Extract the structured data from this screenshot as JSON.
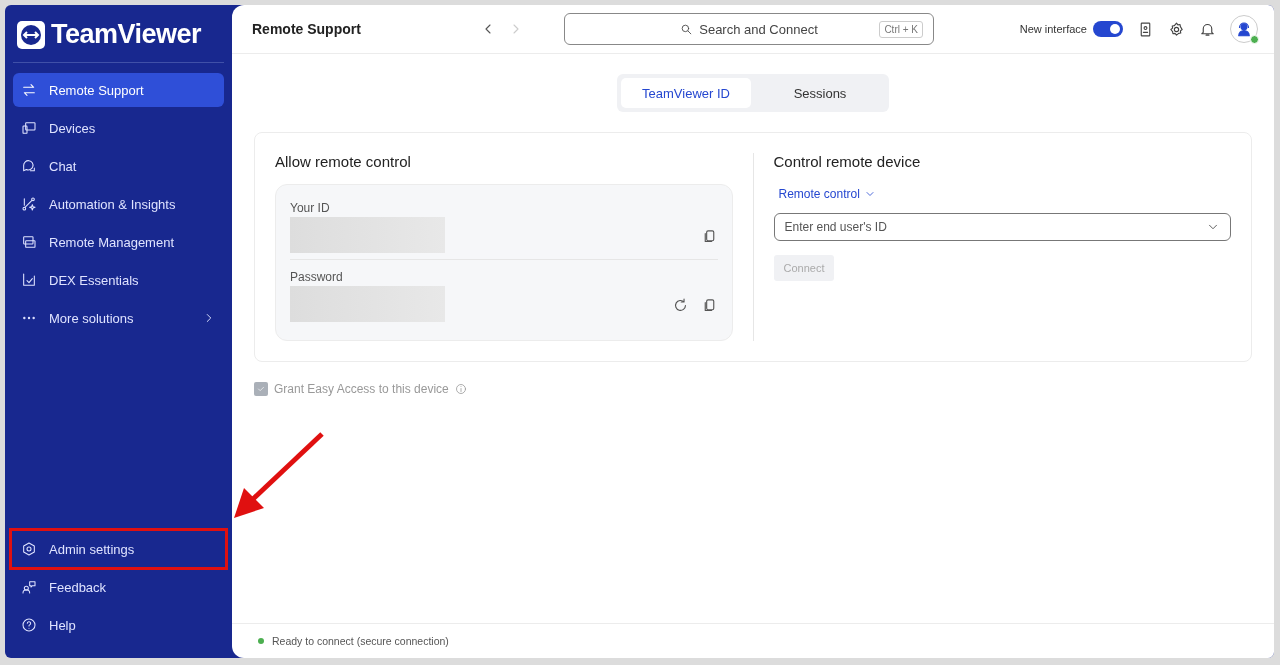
{
  "logo": {
    "text": "TeamViewer"
  },
  "sidebar": {
    "items": [
      {
        "label": "Remote Support",
        "selected": true,
        "submenu": false
      },
      {
        "label": "Devices",
        "selected": false,
        "submenu": false
      },
      {
        "label": "Chat",
        "selected": false,
        "submenu": false
      },
      {
        "label": "Automation & Insights",
        "selected": false,
        "submenu": false
      },
      {
        "label": "Remote Management",
        "selected": false,
        "submenu": false
      },
      {
        "label": "DEX Essentials",
        "selected": false,
        "submenu": false
      },
      {
        "label": "More solutions",
        "selected": false,
        "submenu": true
      }
    ],
    "bottom_items": [
      {
        "label": "Admin settings",
        "selected": false,
        "highlighted": true
      },
      {
        "label": "Feedback",
        "selected": false,
        "highlighted": false
      },
      {
        "label": "Help",
        "selected": false,
        "highlighted": false
      }
    ]
  },
  "header": {
    "title": "Remote Support",
    "back_disabled": false,
    "forward_disabled": true,
    "search": {
      "placeholder": "Search and Connect",
      "shortcut": "Ctrl + K"
    },
    "toggle": {
      "label": "New interface",
      "on": true
    },
    "avatar": {
      "online": true
    }
  },
  "tabs": [
    {
      "label": "TeamViewer ID",
      "selected": true
    },
    {
      "label": "Sessions",
      "selected": false
    }
  ],
  "allow_panel": {
    "title": "Allow remote control",
    "fields": [
      {
        "label": "Your ID",
        "refresh": false
      },
      {
        "label": "Password",
        "refresh": true
      }
    ]
  },
  "control_panel": {
    "title": "Control remote device",
    "mode": "Remote control",
    "id_field": {
      "placeholder": "Enter end user's ID"
    },
    "connect": {
      "label": "Connect",
      "disabled": true
    }
  },
  "easy_access": {
    "label": "Grant Easy Access to this device",
    "checked": true,
    "disabled": true
  },
  "status_bar": {
    "text": "Ready to connect (secure connection)",
    "color": "#4caf50"
  }
}
